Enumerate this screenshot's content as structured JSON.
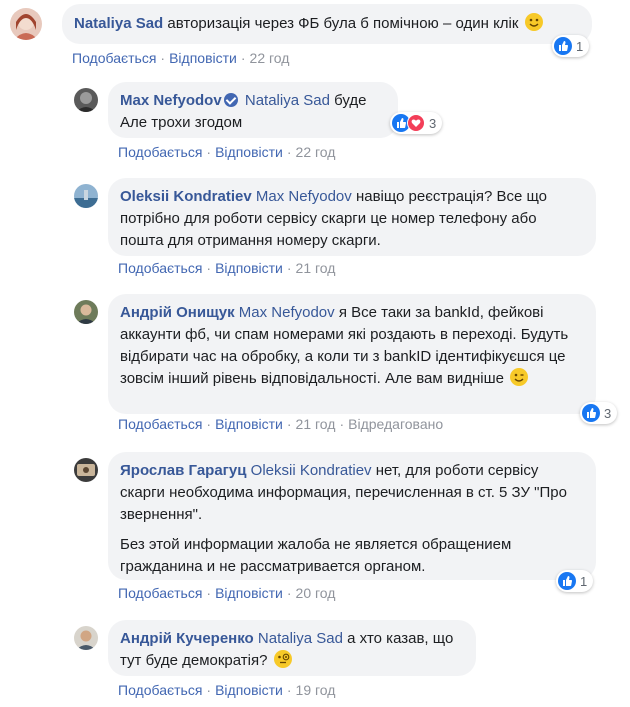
{
  "actions": {
    "like": "Подобається",
    "reply": "Відповісти",
    "sep": "·"
  },
  "comments": [
    {
      "author": "Nataliya Sad",
      "text": "авторизація через ФБ була б помічною – один клік",
      "emoji": "smile-emoji",
      "time": "22 год",
      "reactions": {
        "count": "1",
        "types": [
          "like"
        ]
      }
    },
    {
      "author": "Max Nefyodov",
      "verified": true,
      "mention": "Nataliya Sad",
      "text_line1": "буде",
      "text_line2": "Але трохи згодом",
      "time": "22 год",
      "reactions": {
        "count": "3",
        "types": [
          "like",
          "love"
        ]
      }
    },
    {
      "author": "Oleksii Kondratiev",
      "mention": "Max Nefyodov",
      "text": "навіщо реєстрація? Все що потрібно для роботи сервісу скарги це номер телефону або пошта для отримання номеру скарги.",
      "time": "21 год"
    },
    {
      "author": "Андрій Онищук",
      "mention": "Max Nefyodov",
      "text": "я Все таки за bankId, фейкові аккаунти фб, чи спам номерами які роздають в переході. Будуть відбирати час на обробку, а коли ти з bankID ідентифікуєшся це зовсім інший рівень відповідальності. Але вам видніше",
      "emoji": "wink-emoji",
      "time": "21 год",
      "edited": "Відредаговано",
      "reactions": {
        "count": "3",
        "types": [
          "like"
        ]
      }
    },
    {
      "author": "Ярослав Гарагуц",
      "mention": "Oleksii Kondratiev",
      "text": "нет, для роботи сервісу скарги необходима информация, перечисленная в ст. 5 ЗУ \"Про звернення\".",
      "text2": "Без этой информации жалоба не является обращением гражданина и не рассматривается органом.",
      "time": "20 год",
      "reactions": {
        "count": "1",
        "types": [
          "like"
        ]
      }
    },
    {
      "author": "Андрій Кучеренко",
      "mention": "Nataliya Sad",
      "text": "а хто казав, що тут буде демократія?",
      "emoji": "monocle-emoji",
      "time": "19 год"
    }
  ]
}
